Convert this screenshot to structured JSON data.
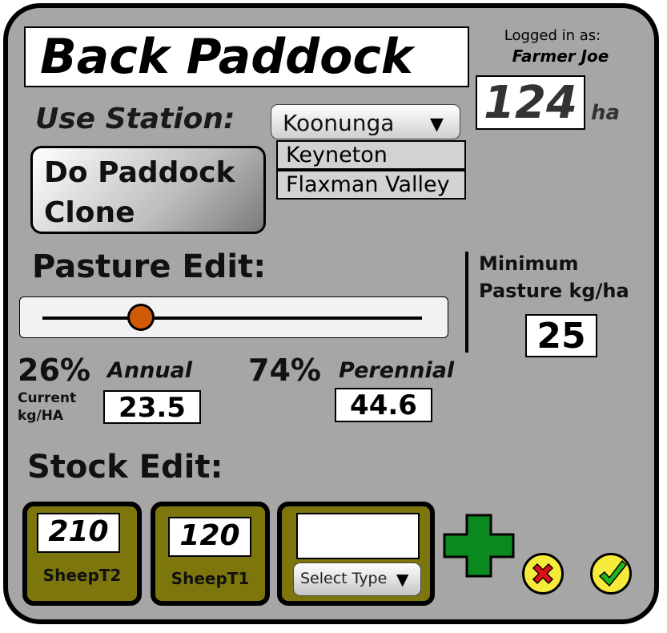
{
  "paddock": {
    "name": "Back Paddock",
    "area": "124",
    "area_unit": "ha"
  },
  "user": {
    "label": "Logged in as:",
    "name": "Farmer Joe"
  },
  "station": {
    "label": "Use Station:",
    "selected": "Koonunga",
    "options": [
      "Keyneton",
      "Flaxman Valley"
    ]
  },
  "clone_button": {
    "line1": "Do Paddock",
    "line2": "Clone"
  },
  "pasture": {
    "heading": "Pasture Edit:",
    "slider_annual_fraction": 0.26,
    "minimum": {
      "line1": "Minimum",
      "line2": "Pasture kg/ha",
      "value": "25"
    },
    "annual": {
      "pct": "26%",
      "label": "Annual",
      "value": "23.5"
    },
    "perennial": {
      "pct": "74%",
      "label": "Perennial",
      "value": "44.6"
    },
    "current_label": {
      "line1": "Current",
      "line2": "kg/HA"
    }
  },
  "stock": {
    "heading": "Stock Edit:",
    "items": [
      {
        "count": "210",
        "type": "SheepT2"
      },
      {
        "count": "120",
        "type": "SheepT1"
      }
    ],
    "new_item": {
      "count": "",
      "type_placeholder": "Select Type"
    }
  },
  "colors": {
    "background": "#a6a6a6",
    "stock_card": "#7c760c",
    "slider_thumb": "#d15a08",
    "add": "#0a8a1e",
    "cancel": "#e01010",
    "confirm": "#1fb81f",
    "round_button": "#f6ea3a"
  }
}
